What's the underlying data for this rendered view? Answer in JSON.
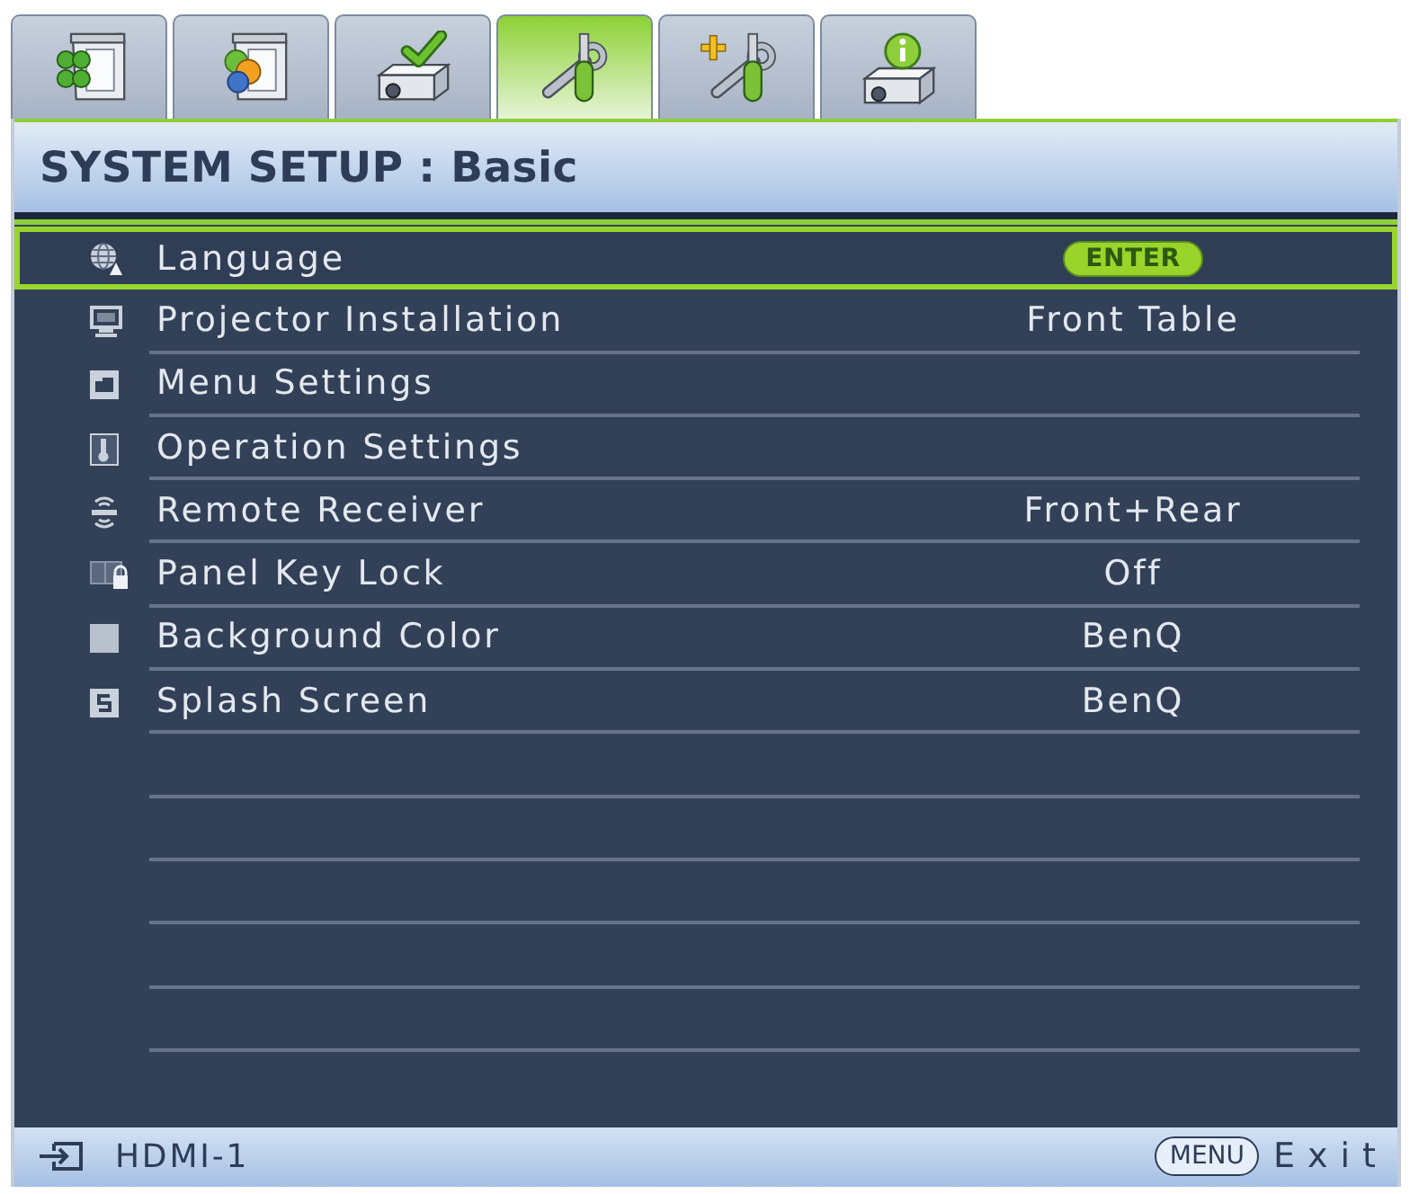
{
  "tabs": [
    {
      "selected": false
    },
    {
      "selected": false
    },
    {
      "selected": false
    },
    {
      "selected": true
    },
    {
      "selected": false
    },
    {
      "selected": false
    }
  ],
  "header": {
    "title": "SYSTEM SETUP : Basic"
  },
  "menu": {
    "items": [
      {
        "label": "Language",
        "badge": "ENTER",
        "selected": true
      },
      {
        "label": "Projector Installation",
        "value": "Front Table",
        "selected": false
      },
      {
        "label": "Menu Settings",
        "selected": false
      },
      {
        "label": "Operation Settings",
        "selected": false
      },
      {
        "label": "Remote Receiver",
        "value": "Front+Rear",
        "selected": false
      },
      {
        "label": "Panel Key Lock",
        "value": "Off",
        "selected": false
      },
      {
        "label": "Background Color",
        "value": "BenQ",
        "selected": false
      },
      {
        "label": "Splash Screen",
        "value": "BenQ",
        "selected": false
      }
    ]
  },
  "footer": {
    "source": "HDMI-1",
    "menu_key": "MENU",
    "exit_label": "Exit"
  }
}
